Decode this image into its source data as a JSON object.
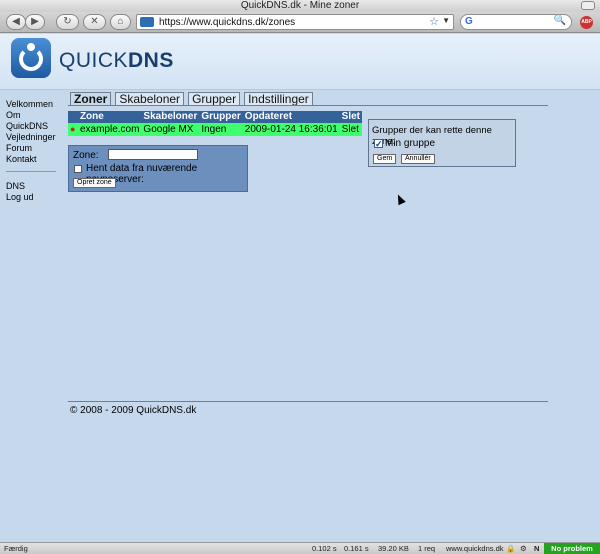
{
  "window": {
    "title": "QuickDNS.dk - Mine zoner"
  },
  "toolbar": {
    "back": "◀",
    "forward": "▶",
    "reload": "↻",
    "stop": "✕",
    "home": "⌂",
    "url": "https://www.quickdns.dk/zones",
    "search_engine": "G",
    "search_placeholder": "",
    "search_icon": "🔍",
    "addon_badge": "ABP"
  },
  "header": {
    "brand_light": "QUICK",
    "brand_bold": "DNS"
  },
  "sidebar": {
    "items": [
      "Velkommen",
      "Om QuickDNS",
      "Vejledninger",
      "Forum",
      "Kontakt"
    ],
    "items2": [
      "DNS",
      "Log ud"
    ]
  },
  "tabs": [
    "Zoner",
    "Skabeloner",
    "Grupper",
    "Indstillinger"
  ],
  "zones_table": {
    "headers": [
      "Zone",
      "Skabeloner",
      "Grupper",
      "Opdateret",
      "Slet"
    ],
    "rows": [
      {
        "bullet": "●",
        "zone": "example.com",
        "template": "Google MX",
        "groups": "Ingen",
        "updated": "2009-01-24 16:36:01",
        "delete": "Slet"
      }
    ]
  },
  "create_zone": {
    "label": "Zone:",
    "value": "",
    "fetch_label": "Hent data fra nuværende navneserver:",
    "button": "Opret zone"
  },
  "groups_panel": {
    "title": "Grupper der kan rette denne zone:",
    "group_label": "Min gruppe",
    "checkmark": "✓",
    "save": "Gem",
    "cancel": "Annullér"
  },
  "footer": {
    "text": "© 2008 - 2009 QuickDNS.dk"
  },
  "statusbar": {
    "left": "Færdig",
    "t1": "0.102 s",
    "t2": "0.161 s",
    "size": "39.20 KB",
    "req": "1 req",
    "host": "www.quickdns.dk",
    "status": "No problem"
  }
}
